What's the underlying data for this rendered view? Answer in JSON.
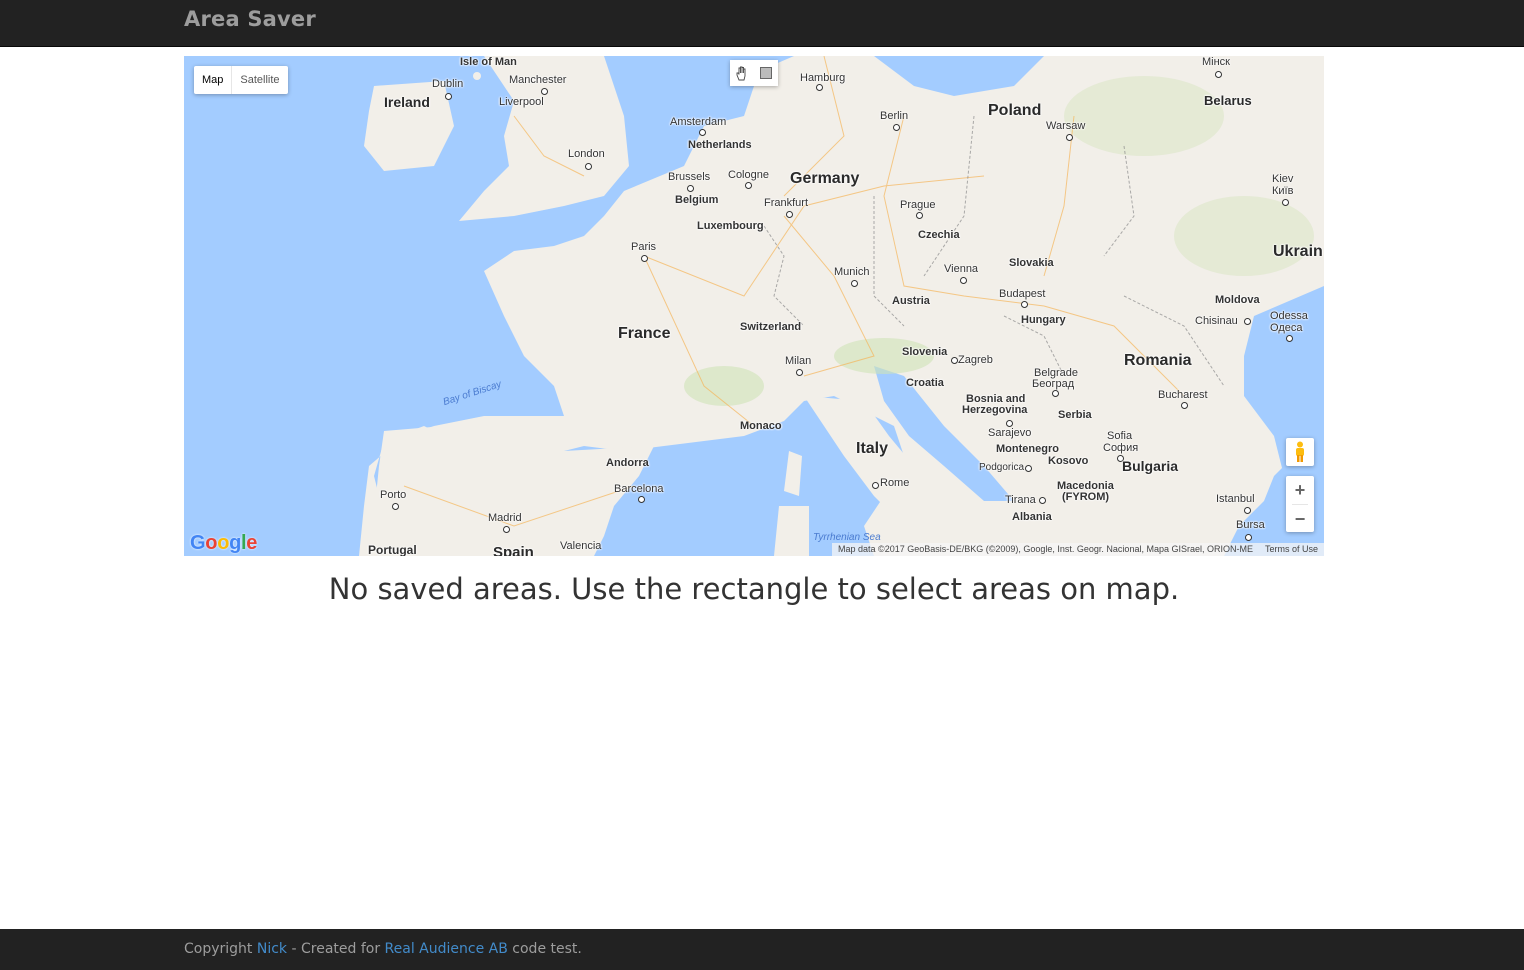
{
  "app": {
    "title": "Area Saver"
  },
  "map": {
    "type_buttons": {
      "map": "Map",
      "satellite": "Satellite"
    },
    "labels": {
      "isle_of_man": "Isle of Man",
      "dublin": "Dublin",
      "manchester": "Manchester",
      "liverpool": "Liverpool",
      "ireland": "Ireland",
      "london": "London",
      "amsterdam": "Amsterdam",
      "netherlands": "Netherlands",
      "hamburg": "Hamburg",
      "berlin": "Berlin",
      "poland": "Poland",
      "warsaw": "Warsaw",
      "minsk": "Мінск",
      "belarus": "Belarus",
      "brussels": "Brussels",
      "belgium": "Belgium",
      "cologne": "Cologne",
      "germany": "Germany",
      "frankfurt": "Frankfurt",
      "prague": "Prague",
      "luxembourg": "Luxembourg",
      "czechia": "Czechia",
      "kiev": "Kiev",
      "kyiv": "Київ",
      "paris": "Paris",
      "ukraine": "Ukrain",
      "slovakia": "Slovakia",
      "vienna": "Vienna",
      "munich": "Munich",
      "budapest": "Budapest",
      "austria": "Austria",
      "moldova": "Moldova",
      "france": "France",
      "switzerland": "Switzerland",
      "hungary": "Hungary",
      "chisinau": "Chisinau",
      "odessa": "Odessa",
      "odesa": "Одеса",
      "slovenia": "Slovenia",
      "zagreb": "Zagreb",
      "milan": "Milan",
      "romania": "Romania",
      "belgrade": "Belgrade",
      "beograd": "Београд",
      "croatia": "Croatia",
      "bay_of_biscay": "Bay of Biscay",
      "bosnia": "Bosnia and",
      "herzegovina": "Herzegovina",
      "serbia": "Serbia",
      "bucharest": "Bucharest",
      "monaco": "Monaco",
      "sarajevo": "Sarajevo",
      "sofia": "Sofia",
      "sofiya": "София",
      "montenegro": "Montenegro",
      "italy": "Italy",
      "andorra": "Andorra",
      "podgorica": "Podgorica",
      "kosovo": "Kosovo",
      "bulgaria": "Bulgaria",
      "rome": "Rome",
      "barcelona": "Barcelona",
      "porto": "Porto",
      "tirana": "Tirana",
      "macedonia": "Macedonia",
      "fyrom": "(FYROM)",
      "istanbul": "Istanbul",
      "madrid": "Madrid",
      "albania": "Albania",
      "bursa": "Bursa",
      "tyrrhenian": "Tyrrhenian Sea",
      "valencia": "Valencia",
      "portugal": "Portugal",
      "spain": "Spain"
    },
    "icons": {
      "hand": "hand-icon",
      "rectangle": "rectangle-icon",
      "pegman": "pegman-icon"
    },
    "zoom": {
      "in": "+",
      "out": "−"
    },
    "logo": [
      "G",
      "o",
      "o",
      "g",
      "l",
      "e"
    ],
    "attribution": "Map data ©2017 GeoBasis-DE/BKG (©2009), Google, Inst. Geogr. Nacional, Mapa GISrael, ORION-ME",
    "terms": "Terms of Use"
  },
  "message": "No saved areas. Use the rectangle to select areas on map.",
  "footer": {
    "prefix": "Copyright ",
    "author": "Nick",
    "middle": " - Created for ",
    "company": "Real Audience AB",
    "suffix": " code test."
  },
  "colors": {
    "navbar": "#222222",
    "brand": "#9d9d9d",
    "water": "#a3ccff",
    "land": "#f2efe9",
    "link": "#428bca"
  }
}
